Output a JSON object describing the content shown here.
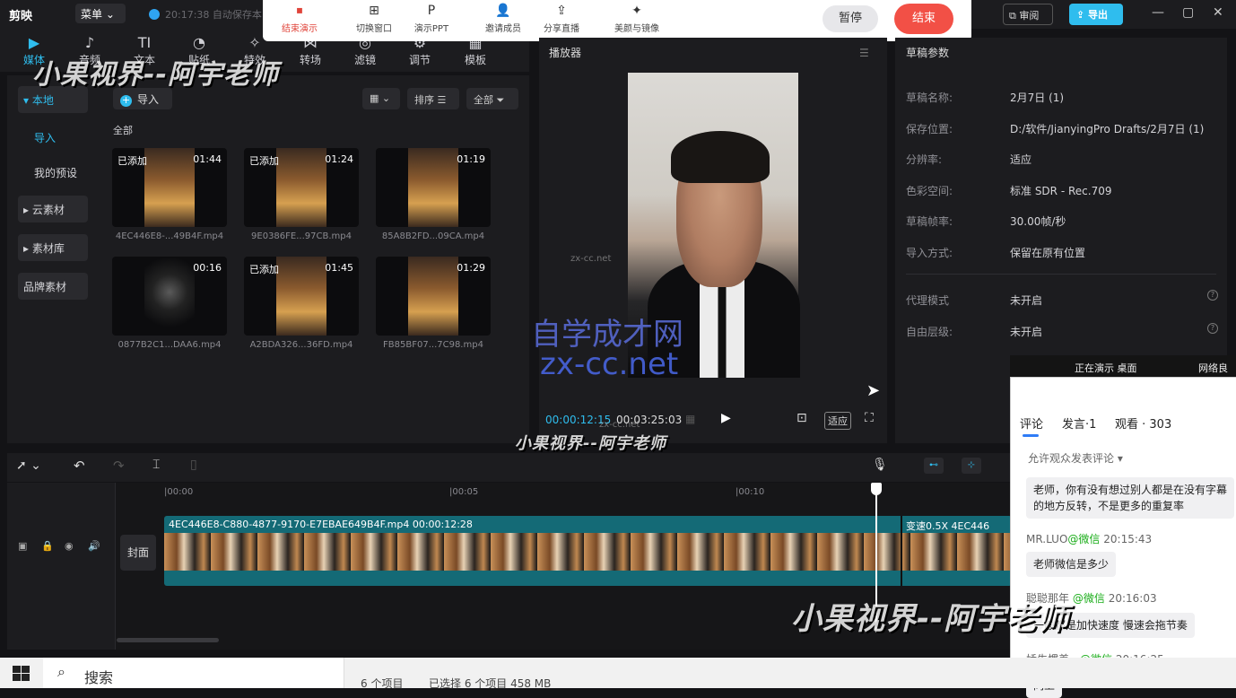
{
  "app": {
    "logo_text": "剪映",
    "menu_label": "菜单",
    "autosave_text": "20:17:38 自动保存本",
    "review_label": "审阅",
    "export_label": "导出",
    "window_controls": [
      "—",
      "▢",
      "✕"
    ]
  },
  "presentation_toolbar": {
    "items": [
      {
        "label": "结束演示",
        "icon": "screen-end-icon",
        "glyph": "⏹"
      },
      {
        "label": "切换窗口",
        "icon": "switch-window-icon",
        "glyph": "⊞"
      },
      {
        "label": "演示PPT",
        "icon": "ppt-icon",
        "glyph": "P"
      },
      {
        "label": "邀请成员",
        "icon": "invite-member-icon",
        "glyph": "👤"
      },
      {
        "label": "分享直播",
        "icon": "share-live-icon",
        "glyph": "⇪"
      },
      {
        "label": "美颜与镜像",
        "icon": "beauty-sparkle-icon",
        "glyph": "✦"
      }
    ],
    "pause_label": "暂停",
    "end_label": "结束"
  },
  "media_tabs": [
    {
      "label": "媒体",
      "glyph": "▶"
    },
    {
      "label": "音频",
      "glyph": "♪"
    },
    {
      "label": "文本",
      "glyph": "TI"
    },
    {
      "label": "贴纸",
      "glyph": "◔"
    },
    {
      "label": "特效",
      "glyph": "✧"
    },
    {
      "label": "转场",
      "glyph": "⋈"
    },
    {
      "label": "滤镜",
      "glyph": "◎"
    },
    {
      "label": "调节",
      "glyph": "⚙"
    },
    {
      "label": "模板",
      "glyph": "▦"
    }
  ],
  "left_nav": {
    "local": "▾ 本地",
    "import": "导入",
    "presets": "我的预设",
    "cloud": "▸ 云素材",
    "library": "▸ 素材库",
    "brand": "品牌素材"
  },
  "media_panel": {
    "import_label": "导入",
    "sort_label": "排序",
    "all_filter_label": "全部",
    "all_label": "全部",
    "clips": [
      {
        "added": "已添加",
        "duration": "01:44",
        "name": "4EC446E8-...49B4F.mp4"
      },
      {
        "added": "已添加",
        "duration": "01:24",
        "name": "9E0386FE...97CB.mp4"
      },
      {
        "added": "",
        "duration": "01:19",
        "name": "85A8B2FD...09CA.mp4"
      },
      {
        "added": "",
        "duration": "00:16",
        "name": "0877B2C1...DAA6.mp4"
      },
      {
        "added": "已添加",
        "duration": "01:45",
        "name": "A2BDA326...36FD.mp4"
      },
      {
        "added": "",
        "duration": "01:29",
        "name": "FB85BF07...7C98.mp4"
      }
    ]
  },
  "player": {
    "title": "播放器",
    "current_time": "00:00:12:15",
    "total_time": "00:03:25:03",
    "fit_label": "适应"
  },
  "draft": {
    "title": "草稿参数",
    "rows": [
      {
        "label": "草稿名称:",
        "value": "2月7日 (1)"
      },
      {
        "label": "保存位置:",
        "value": "D:/软件/JianyingPro Drafts/2月7日 (1)"
      },
      {
        "label": "分辨率:",
        "value": "适应"
      },
      {
        "label": "色彩空间:",
        "value": "标准 SDR - Rec.709"
      },
      {
        "label": "草稿帧率:",
        "value": "30.00帧/秒"
      },
      {
        "label": "导入方式:",
        "value": "保留在原有位置"
      },
      {
        "label": "代理模式",
        "value": "未开启"
      },
      {
        "label": "自由层级:",
        "value": "未开启"
      }
    ]
  },
  "timeline": {
    "ruler": [
      "|00:00",
      "|00:05",
      "|00:10"
    ],
    "cover_label": "封面",
    "clip_label": "4EC446E8-C880-4877-9170-E7EBAE649B4F.mp4   00:00:12:28",
    "speed_label": "变速0.5X  4EC446"
  },
  "comments": {
    "top_text": "正在演示 桌面",
    "top_right": "网络良",
    "tabs": [
      "评论",
      "发言·1",
      "观看 · 303"
    ],
    "allow_label": "允许观众发表评论 ▾",
    "messages": [
      {
        "text": "老师，你有没有想过别人都是在没有字幕的地方反转，不是更多的重复率"
      },
      {
        "user": "MR.LUO",
        "via": "@微信",
        "time": "20:15:43",
        "text": "老师微信是多少"
      },
      {
        "user": "聪聪那年",
        "via": "@微信",
        "time": "20:16:03",
        "text": "一般都是加快速度 慢速会拖节奏"
      },
      {
        "user": "娇生惯养。",
        "via": "@微信",
        "time": "20:16:25",
        "text": "同上"
      }
    ]
  },
  "taskbar": {
    "search_label": "搜索",
    "items_count": "6 个项目",
    "selected": "已选择 6 个项目  458 MB"
  },
  "watermarks": {
    "brand_top": "小果视界--阿宇老师",
    "brand_mid": "小果视界--阿宇老师",
    "brand_bottom": "小果视界--阿宇老师",
    "site_cn": "自学成才网",
    "site_url": "zx-cc.net",
    "small": "zx-cc.net"
  },
  "colors": {
    "accent": "#2fbdee",
    "end_button": "#f25046",
    "track": "#146a76"
  }
}
